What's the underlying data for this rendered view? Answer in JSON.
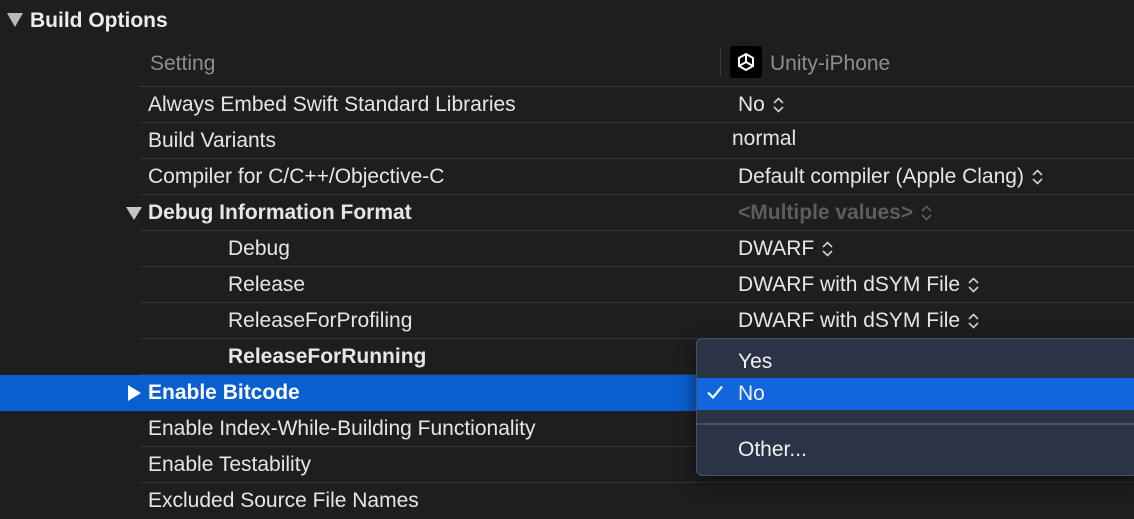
{
  "section": {
    "title": "Build Options"
  },
  "columns": {
    "setting": "Setting",
    "target": "Unity-iPhone",
    "target_icon": "unity-logo-icon"
  },
  "rows": [
    {
      "label": "Always Embed Swift Standard Libraries",
      "value": "No",
      "has_stepper": true
    },
    {
      "label": "Build Variants",
      "value": "normal",
      "has_stepper": false
    },
    {
      "label": "Compiler for C/C++/Objective-C",
      "value": "Default compiler (Apple Clang)",
      "has_stepper": true
    },
    {
      "label": "Debug Information Format",
      "value": "<Multiple values>",
      "has_stepper": true,
      "expanded": true
    },
    {
      "label": "Debug",
      "value": "DWARF",
      "has_stepper": true
    },
    {
      "label": "Release",
      "value": "DWARF with dSYM File",
      "has_stepper": true
    },
    {
      "label": "ReleaseForProfiling",
      "value": "DWARF with dSYM File",
      "has_stepper": true
    },
    {
      "label": "ReleaseForRunning",
      "value": "",
      "has_stepper": false
    },
    {
      "label": "Enable Bitcode",
      "value": "",
      "has_stepper": false,
      "selected": true
    },
    {
      "label": "Enable Index-While-Building Functionality",
      "value": "",
      "has_stepper": false
    },
    {
      "label": "Enable Testability",
      "value": "",
      "has_stepper": false
    },
    {
      "label": "Excluded Source File Names",
      "value": "",
      "has_stepper": false
    }
  ],
  "popup_menu": {
    "items": [
      {
        "label": "Yes",
        "checked": false
      },
      {
        "label": "No",
        "checked": true
      },
      {
        "label": "Other..."
      }
    ]
  },
  "colors": {
    "selection": "#0a5fd0",
    "menu_highlight": "#1166dd",
    "background": "#1e1e20"
  }
}
